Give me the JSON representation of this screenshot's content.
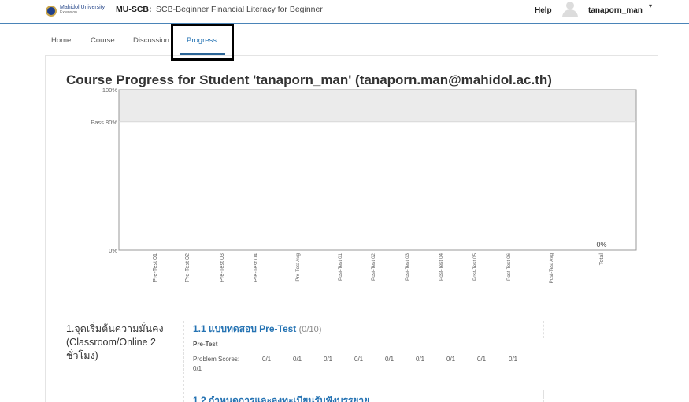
{
  "header": {
    "logo_line1": "Mahidol University",
    "logo_line2": "Extension",
    "course_code": "MU-SCB:",
    "course_name": "SCB-Beginner Financial Literacy for Beginner",
    "help_label": "Help",
    "username": "tanaporn_man",
    "caret": "▾"
  },
  "nav": {
    "tabs": [
      {
        "label": "Home"
      },
      {
        "label": "Course"
      },
      {
        "label": "Discussion"
      },
      {
        "label": "Progress",
        "active": true
      }
    ]
  },
  "page": {
    "title": "Course Progress for Student 'tanaporn_man' (tanaporn.man@mahidol.ac.th)"
  },
  "chart_data": {
    "type": "bar",
    "categories": [
      "Pre-Test 01",
      "Pre-Test 02",
      "Pre-Test 03",
      "Pre-Test 04",
      "Pre-Test Avg",
      "Post-Test 01",
      "Post-Test 02",
      "Post-Test 03",
      "Post-Test 04",
      "Post-Test 05",
      "Post-Test 06",
      "Post-Test Avg",
      "Total"
    ],
    "values": [
      0,
      0,
      0,
      0,
      0,
      0,
      0,
      0,
      0,
      0,
      0,
      0,
      0
    ],
    "data_labels": {
      "Total": "0%"
    },
    "y_ticks": [
      "100%",
      "Pass 80%",
      "0%"
    ],
    "ylim": [
      0,
      100
    ],
    "pass_threshold": 80,
    "grid": false,
    "colors": {
      "pass_band": "#ebebeb",
      "frame": "#999999"
    }
  },
  "chapter": {
    "title": "1.จุดเริ่มต้นความมั่นคง (Classroom/Online 2 ชั่วโมง)"
  },
  "sections": [
    {
      "title": "1.1 แบบทดสอบ Pre-Test",
      "score": "(0/10)",
      "subtitle": "Pre-Test",
      "scores_label": "Problem Scores:",
      "problem_scores": [
        "0/1",
        "0/1",
        "0/1",
        "0/1",
        "0/1",
        "0/1",
        "0/1",
        "0/1",
        "0/1"
      ],
      "overflow_score": "0/1"
    },
    {
      "title": "1.2 กำหนดการและลงทะเบียนรับฟังบรรยาย"
    }
  ],
  "colors": {
    "accent": "#2573b3",
    "header_rule": "#4a84b8"
  }
}
